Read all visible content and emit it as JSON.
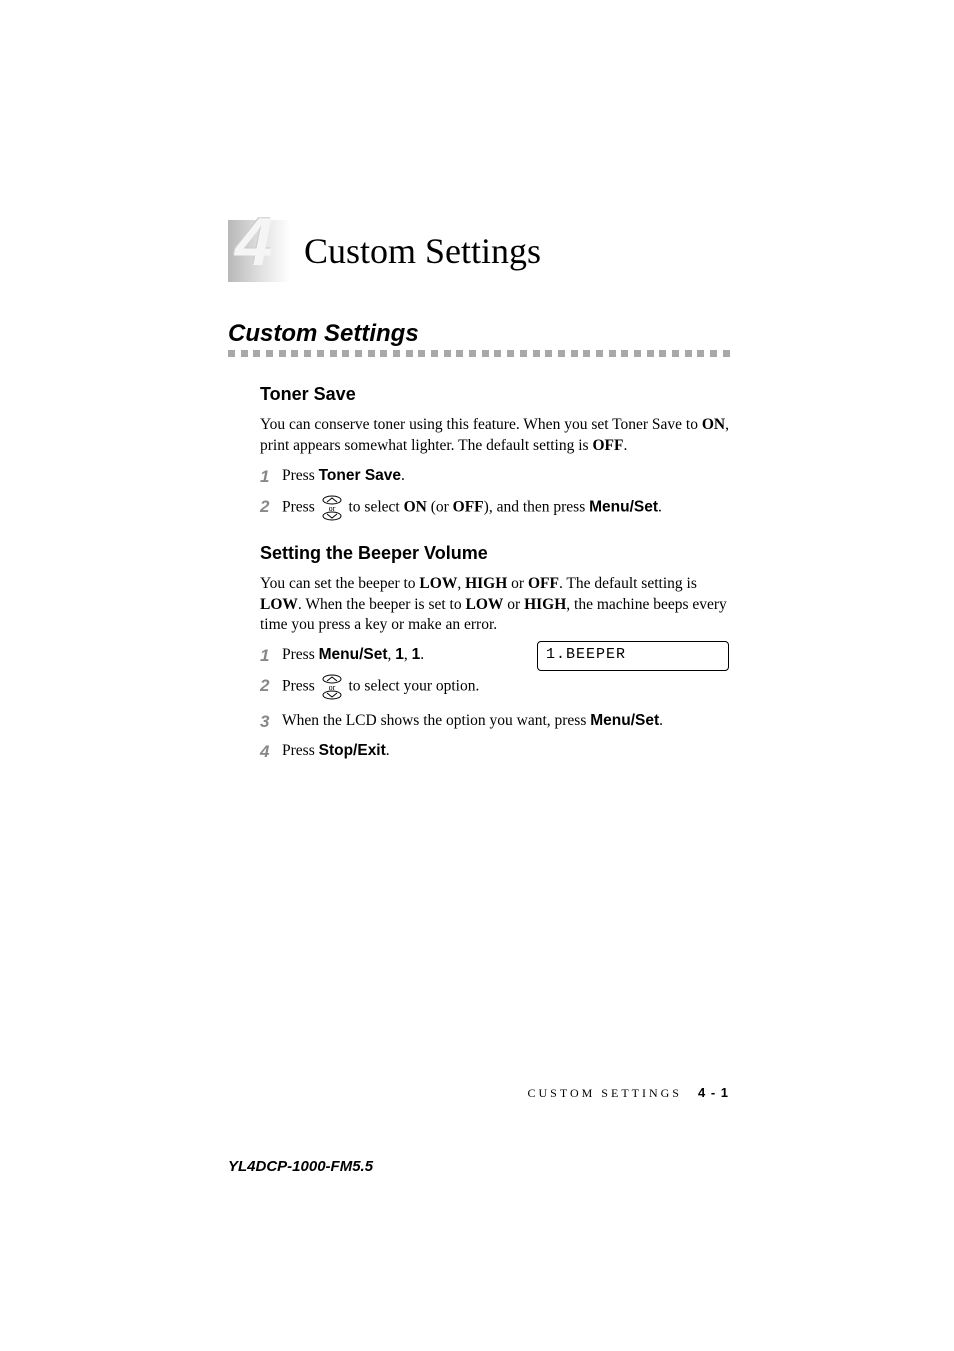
{
  "chapter": {
    "number": "4",
    "title": "Custom Settings"
  },
  "section": {
    "title": "Custom Settings"
  },
  "toner_save": {
    "heading": "Toner Save",
    "para_pre": "You can conserve toner using this feature. When you set Toner Save to ",
    "on": "ON",
    "para_mid": ", print appears somewhat lighter. The default setting is ",
    "off": "OFF",
    "para_end": ".",
    "step1_num": "1",
    "step1_press": "Press ",
    "step1_btn": "Toner Save",
    "step1_end": ".",
    "step2_num": "2",
    "step2_press": "Press ",
    "step2_mid1": " to select ",
    "step2_on": "ON",
    "step2_mid2": " (or ",
    "step2_off": "OFF",
    "step2_mid3": "), and then press ",
    "step2_btn": "Menu/Set",
    "step2_end": "."
  },
  "beeper": {
    "heading": "Setting the Beeper Volume",
    "p1a": "You can set the beeper to ",
    "low": "LOW",
    "p1b": ", ",
    "high": "HIGH",
    "p1c": " or ",
    "off": "OFF",
    "p1d": ". The default setting is ",
    "low2": "LOW",
    "p1e": ". When the beeper is set to ",
    "low3": "LOW",
    "p1f": " or ",
    "high2": "HIGH",
    "p1g": ", the machine beeps every time you press a key or make an error.",
    "step1_num": "1",
    "step1_press": "Press ",
    "step1_btn": "Menu/Set",
    "step1_mid1": ", ",
    "step1_k1": "1",
    "step1_mid2": ", ",
    "step1_k2": "1",
    "step1_end": ".",
    "lcd": "1.BEEPER",
    "step2_num": "2",
    "step2_press": "Press ",
    "step2_end": " to select your option.",
    "step3_num": "3",
    "step3_text": "When the LCD shows the option you want, press ",
    "step3_btn": "Menu/Set",
    "step3_end": ".",
    "step4_num": "4",
    "step4_press": "Press ",
    "step4_btn": "Stop/Exit",
    "step4_end": "."
  },
  "arrow_or": "or",
  "footer": {
    "section": "CUSTOM SETTINGS",
    "page": "4 - 1",
    "doc_id": "YL4DCP-1000-FM5.5"
  }
}
